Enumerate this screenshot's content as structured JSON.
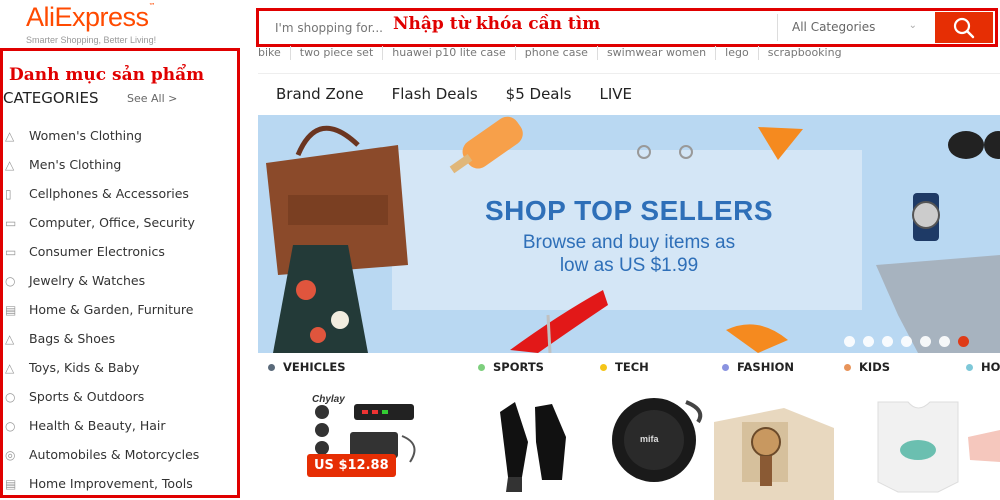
{
  "logo": {
    "text": "AliExpress",
    "tm": "™",
    "tagline": "Smarter Shopping, Better Living!"
  },
  "search": {
    "placeholder": "I'm shopping for...",
    "annotation": "Nhập từ khóa cần tìm",
    "category_label": "All Categories",
    "button_icon": "search-icon"
  },
  "hot_terms": [
    "bike",
    "two piece set",
    "huawei p10 lite case",
    "phone case",
    "swimwear women",
    "lego",
    "scrapbooking"
  ],
  "categories": {
    "annotation": "Danh mục sản phẩm",
    "header": "CATEGORIES",
    "see_all": "See All >",
    "items": [
      {
        "label": "Women's Clothing",
        "icon": "dress-icon"
      },
      {
        "label": "Men's Clothing",
        "icon": "shirt-icon"
      },
      {
        "label": "Cellphones & Accessories",
        "icon": "phone-icon"
      },
      {
        "label": "Computer, Office, Security",
        "icon": "laptop-icon"
      },
      {
        "label": "Consumer Electronics",
        "icon": "tv-icon"
      },
      {
        "label": "Jewelry & Watches",
        "icon": "ring-icon"
      },
      {
        "label": "Home & Garden, Furniture",
        "icon": "chair-icon"
      },
      {
        "label": "Bags & Shoes",
        "icon": "bag-icon"
      },
      {
        "label": "Toys, Kids & Baby",
        "icon": "toy-icon"
      },
      {
        "label": "Sports & Outdoors",
        "icon": "ball-icon"
      },
      {
        "label": "Health & Beauty, Hair",
        "icon": "beauty-icon"
      },
      {
        "label": "Automobiles & Motorcycles",
        "icon": "car-icon"
      },
      {
        "label": "Home Improvement, Tools",
        "icon": "tools-icon"
      }
    ]
  },
  "nav": [
    "Brand Zone",
    "Flash Deals",
    "$5 Deals",
    "LIVE"
  ],
  "banner": {
    "title": "SHOP TOP SELLERS",
    "subtitle": "Browse and buy items as\nlow as US $1.99",
    "slide_count": 7,
    "active_slide": 7
  },
  "tabs": [
    {
      "label": "VEHICLES",
      "color": "#5a6a7a"
    },
    {
      "label": "SPORTS",
      "color": "#7dcf7d"
    },
    {
      "label": "TECH",
      "color": "#f5c518"
    },
    {
      "label": "FASHION",
      "color": "#8a93e0"
    },
    {
      "label": "KIDS",
      "color": "#e8945a"
    },
    {
      "label": "HO",
      "color": "#7ec8d8"
    }
  ],
  "products": {
    "price": "US $12.88",
    "brand1": "Chylay",
    "brand2": "mifa"
  },
  "colors": {
    "brand": "#ff4a00",
    "accent": "#e62e04",
    "annotation": "#e00000",
    "banner_text": "#2e6fb8"
  }
}
